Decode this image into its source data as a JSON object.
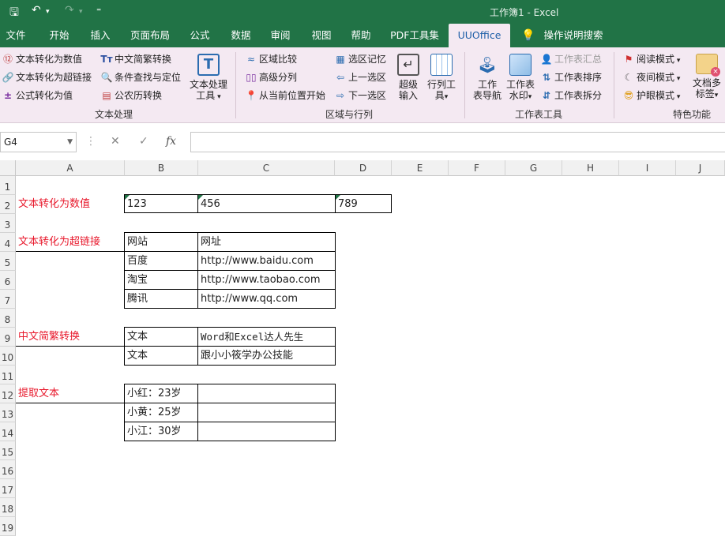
{
  "title": "工作簿1  -  Excel",
  "quick_access": {
    "save": "🖫",
    "undo": "↶",
    "redo": "↷",
    "customize": "⁼"
  },
  "tabs": [
    "文件",
    "开始",
    "插入",
    "页面布局",
    "公式",
    "数据",
    "审阅",
    "视图",
    "帮助",
    "PDF工具集",
    "UUOffice",
    "操作说明搜索"
  ],
  "ribbon": {
    "text_group": {
      "label": "文本处理",
      "items": [
        "文本转化为数值",
        "文本转化为超链接",
        "公式转化为值",
        "中文简繁转换",
        "条件查找与定位",
        "公农历转换"
      ],
      "big": "文本处理\n工具"
    },
    "range_group": {
      "label": "区域与行列",
      "items": [
        "区域比较",
        "高级分列",
        "从当前位置开始",
        "选区记忆",
        "上一选区",
        "下一选区"
      ],
      "big1": "超级\n输入",
      "big2": "行列工\n具"
    },
    "sheet_group": {
      "label": "工作表工具",
      "big1": "工作\n表导航",
      "big2": "工作表\n水印",
      "items": [
        "工作表汇总",
        "工作表排序",
        "工作表拆分"
      ]
    },
    "special_group": {
      "label": "特色功能",
      "items": [
        "阅读模式",
        "夜间模式",
        "护眼模式"
      ],
      "big": "文档多\n标签"
    }
  },
  "formula_bar": {
    "name_box": "G4",
    "formula": "",
    "fx": "fx"
  },
  "columns": [
    "A",
    "B",
    "C",
    "D",
    "E",
    "F",
    "G",
    "H",
    "I",
    "J"
  ],
  "rows": [
    "1",
    "2",
    "3",
    "4",
    "5",
    "6",
    "7",
    "8",
    "9",
    "10",
    "11",
    "12",
    "13",
    "14",
    "15",
    "16",
    "17",
    "18",
    "19"
  ],
  "cells": {
    "A2": "文本转化为数值",
    "B2": "123",
    "C2": "456",
    "D2": "789",
    "A4": "文本转化为超链接",
    "B4": "网站",
    "C4": "网址",
    "B5": "百度",
    "C5": "http://www.baidu.com",
    "B6": "淘宝",
    "C6": "http://www.taobao.com",
    "B7": "腾讯",
    "C7": "http://www.qq.com",
    "A9": "中文简繁转换",
    "B9": "文本",
    "C9": "Word和Excel达人先生",
    "B10": "文本",
    "C10": "跟小小筱学办公技能",
    "A12": "提取文本",
    "B12": "小红：23岁",
    "B13": "小黄：25岁",
    "B14": "小江：30岁"
  },
  "colors": {
    "excel_green": "#217346",
    "ribbon_bg": "#f4e9f2",
    "label_red": "#e8192c",
    "active_tab_text": "#1f5fa8"
  }
}
